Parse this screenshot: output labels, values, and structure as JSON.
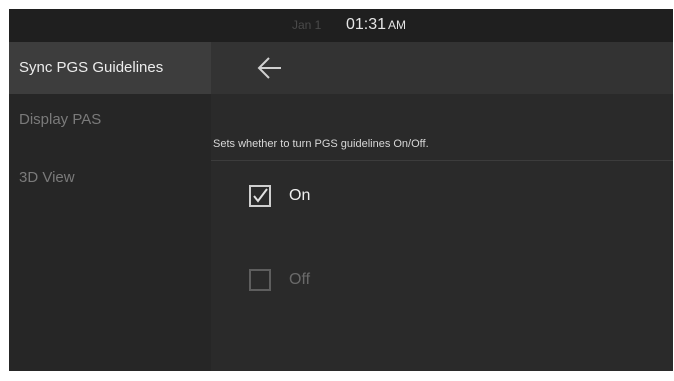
{
  "status_bar": {
    "date": "Jan 1",
    "time": "01:31",
    "ampm": "AM"
  },
  "sidebar": {
    "items": [
      {
        "label": "Sync PGS Guidelines",
        "active": true
      },
      {
        "label": "Display PAS",
        "active": false
      },
      {
        "label": "3D View",
        "active": false
      }
    ]
  },
  "main": {
    "back_icon": "arrow-left-icon",
    "description": "Sets whether to turn PGS guidelines On/Off.",
    "options": [
      {
        "label": "On",
        "checked": true
      },
      {
        "label": "Off",
        "checked": false
      }
    ]
  }
}
